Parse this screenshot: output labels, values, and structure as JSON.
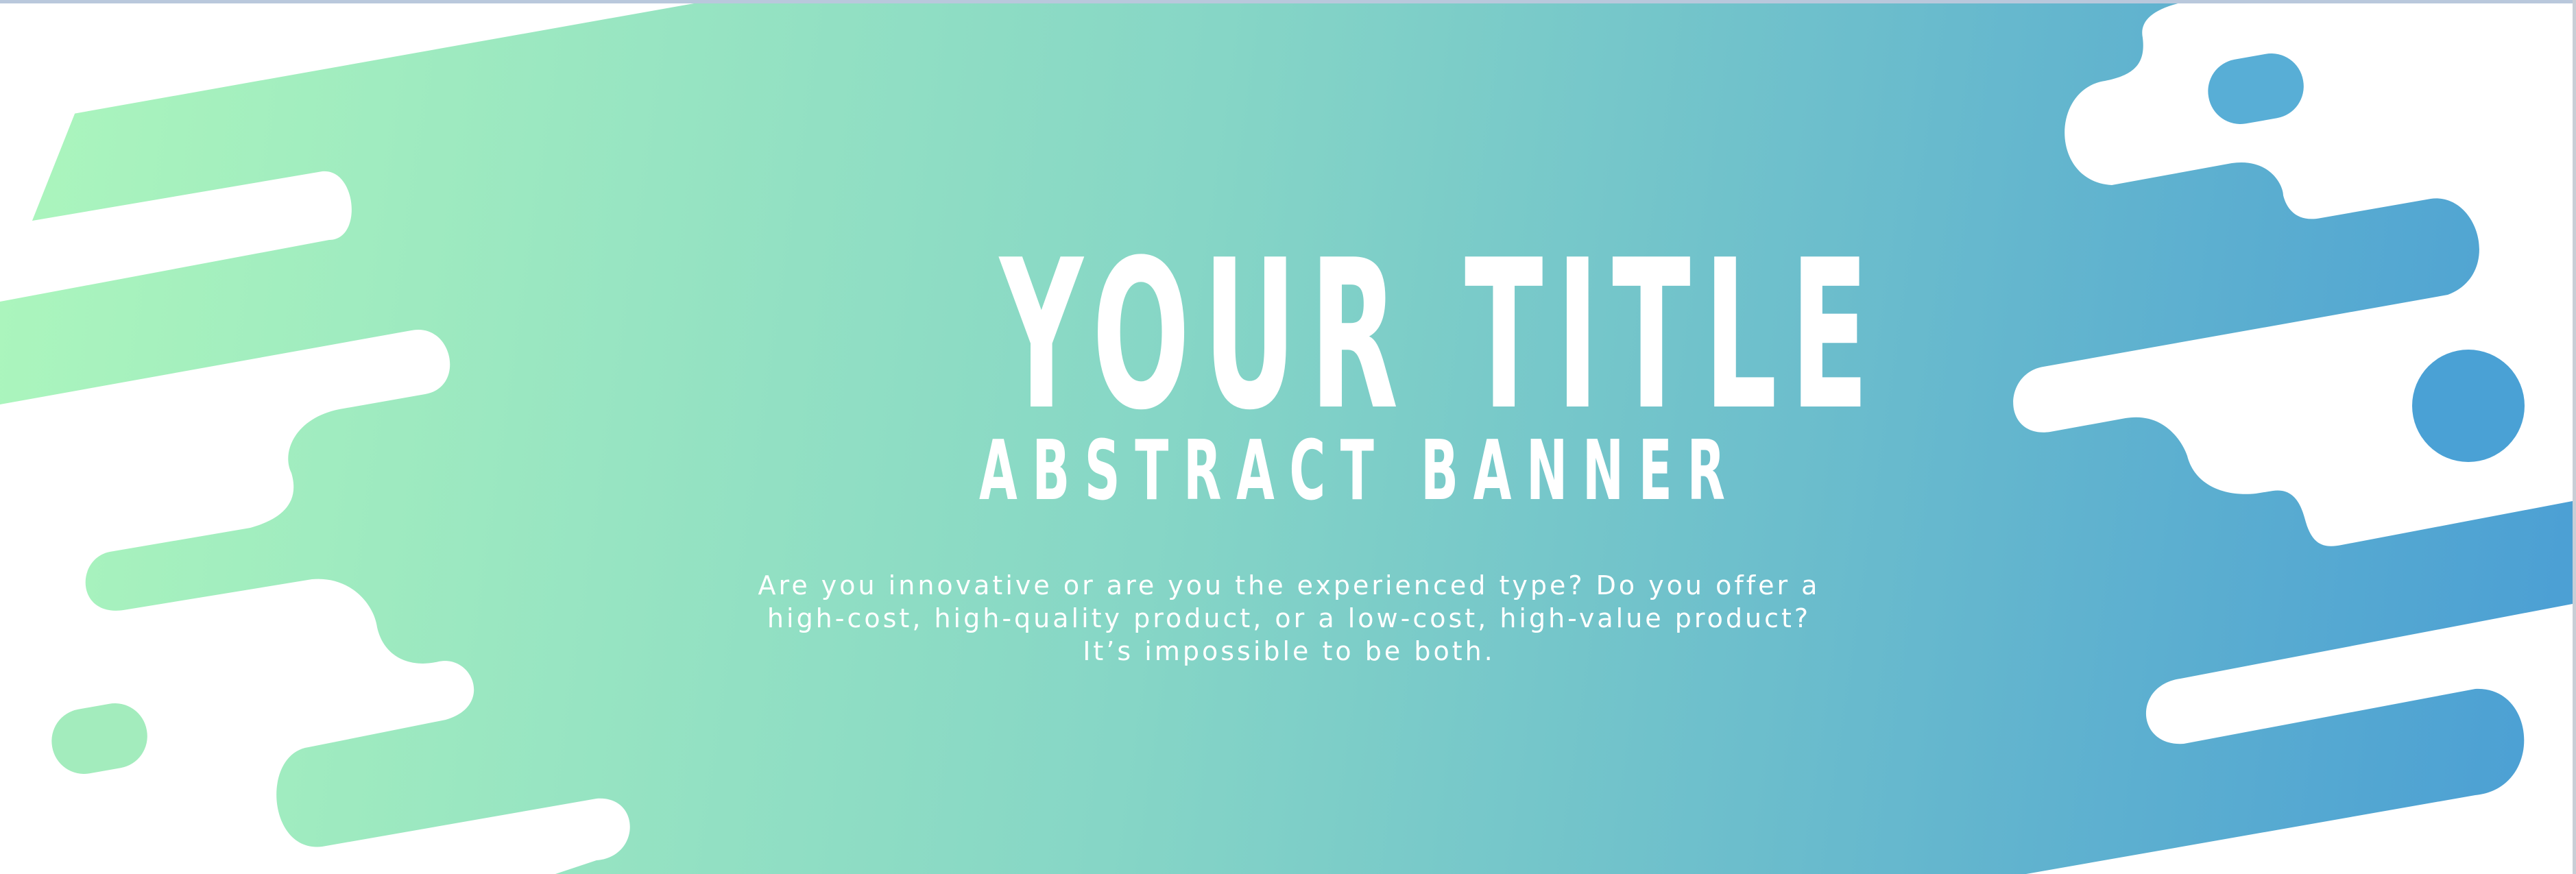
{
  "banner": {
    "title": "YOUR TITLE",
    "subtitle": "ABSTRACT BANNER",
    "description": "Are you innovative or are you the experienced type? Do you offer a high-cost, high-quality product, or a low-cost, high-value product? It’s impossible to be both."
  },
  "colors": {
    "gradient_start": "#abf5bd",
    "gradient_mid": "#86d6c6",
    "gradient_end": "#4b9fd4",
    "text": "#ffffff",
    "background": "#ffffff"
  }
}
